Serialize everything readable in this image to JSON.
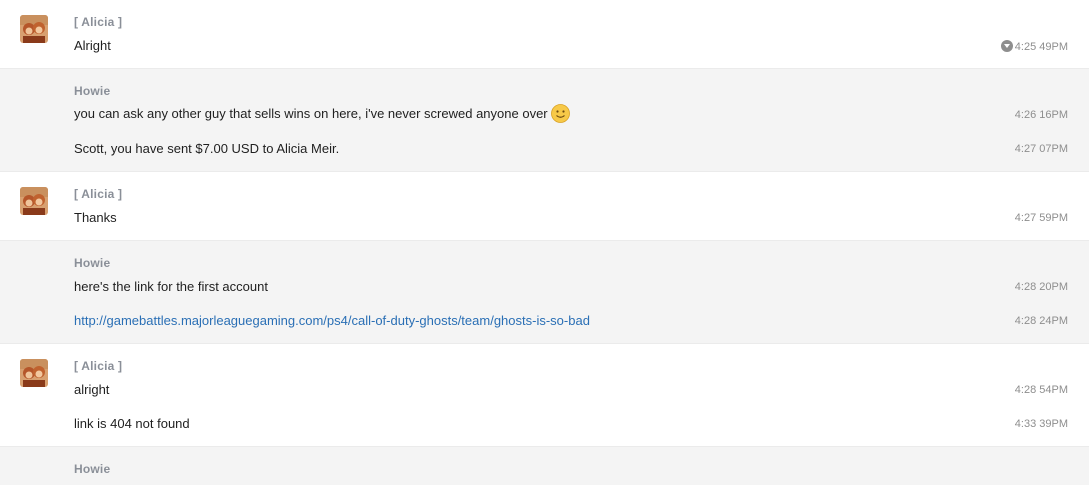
{
  "messages": [
    {
      "sender": "[ Alicia ]",
      "lines": [
        {
          "text": "Alright",
          "time": "4:25 49PM"
        }
      ]
    },
    {
      "sender": "Howie",
      "lines": [
        {
          "text": "you can ask any other guy that sells wins on here, i've never screwed anyone over",
          "time": "4:26 16PM"
        },
        {
          "text": "Scott, you have sent $7.00 USD to Alicia Meir.",
          "time": "4:27 07PM"
        }
      ]
    },
    {
      "sender": "[ Alicia ]",
      "lines": [
        {
          "text": "Thanks",
          "time": "4:27 59PM"
        }
      ]
    },
    {
      "sender": "Howie",
      "lines": [
        {
          "text": "here's the link for the first account",
          "time": "4:28 20PM"
        },
        {
          "text": "http://gamebattles.majorleaguegaming.com/ps4/call-of-duty-ghosts/team/ghosts-is-so-bad",
          "time": "4:28 24PM"
        }
      ]
    },
    {
      "sender": "[ Alicia ]",
      "lines": [
        {
          "text": "alright",
          "time": "4:28 54PM"
        },
        {
          "text": "link is 404 not found",
          "time": "4:33 39PM"
        }
      ]
    },
    {
      "sender": "Howie",
      "lines": []
    }
  ],
  "icons": {
    "avatar": "avatar-photo",
    "emoji": "smiley-emoji-icon",
    "timestamp_menu": "chevron-down-circle-icon"
  },
  "colors": {
    "sender": "#8a8f98",
    "link": "#2a6fb5",
    "timestamp": "#8e8e8e",
    "alt_row": "#f4f4f4"
  }
}
